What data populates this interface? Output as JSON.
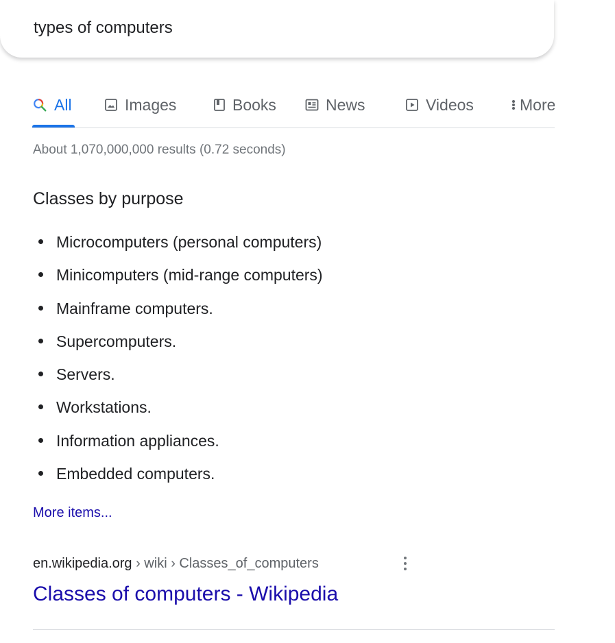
{
  "search": {
    "query": "types of computers"
  },
  "tabs": [
    {
      "label": "All",
      "icon": "search-icon",
      "active": true
    },
    {
      "label": "Images",
      "icon": "image-icon",
      "active": false
    },
    {
      "label": "Books",
      "icon": "book-icon",
      "active": false
    },
    {
      "label": "News",
      "icon": "news-icon",
      "active": false
    },
    {
      "label": "Videos",
      "icon": "video-icon",
      "active": false
    },
    {
      "label": "More",
      "icon": "more-vert-icon",
      "active": false
    }
  ],
  "result_stats": "About 1,070,000,000 results (0.72 seconds)",
  "featured_snippet": {
    "heading": "Classes by purpose",
    "items": [
      "Microcomputers (personal computers)",
      "Minicomputers (mid-range computers)",
      "Mainframe computers.",
      "Supercomputers.",
      "Servers.",
      "Workstations.",
      "Information appliances.",
      "Embedded computers."
    ],
    "more_items_label": "More items..."
  },
  "result": {
    "domain": "en.wikipedia.org",
    "path": " › wiki › Classes_of_computers",
    "title": "Classes of computers - Wikipedia"
  },
  "colors": {
    "accent": "#1a73e8",
    "link": "#1a0dab",
    "text": "#202124",
    "muted": "#70757a"
  }
}
